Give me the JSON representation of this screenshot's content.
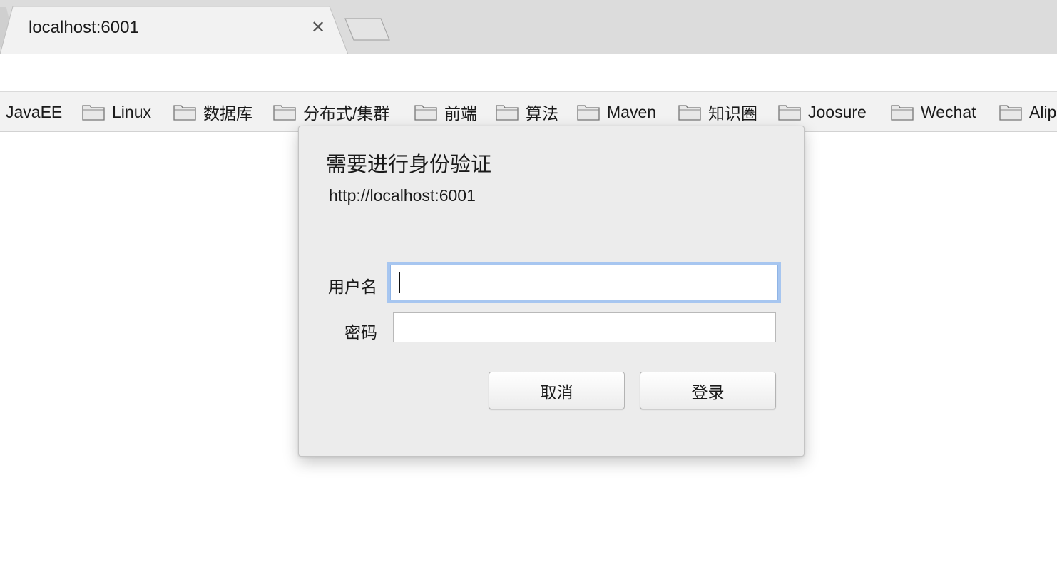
{
  "browser": {
    "tab": {
      "title": "localhost:6001",
      "close_icon": "close-icon"
    },
    "new_tab_icon": "new-tab-icon"
  },
  "bookmarks": [
    {
      "label": "JavaEE",
      "icon": "none"
    },
    {
      "label": "Linux",
      "icon": "folder-icon"
    },
    {
      "label": "数据库",
      "icon": "folder-icon"
    },
    {
      "label": "分布式/集群",
      "icon": "folder-icon"
    },
    {
      "label": "前端",
      "icon": "folder-icon"
    },
    {
      "label": "算法",
      "icon": "folder-icon"
    },
    {
      "label": "Maven",
      "icon": "folder-icon"
    },
    {
      "label": "知识圈",
      "icon": "folder-icon"
    },
    {
      "label": "Joosure",
      "icon": "folder-icon"
    },
    {
      "label": "Wechat",
      "icon": "folder-icon"
    },
    {
      "label": "Alip",
      "icon": "folder-icon"
    }
  ],
  "auth_dialog": {
    "title": "需要进行身份验证",
    "origin": "http://localhost:6001",
    "username_label": "用户名",
    "username_value": "",
    "password_label": "密码",
    "password_value": "",
    "cancel_label": "取消",
    "login_label": "登录"
  },
  "colors": {
    "tabstrip": "#dcdcdc",
    "active_tab": "#f2f2f2",
    "dialog_bg": "#ececec",
    "focus_ring": "#a7c6f0"
  }
}
